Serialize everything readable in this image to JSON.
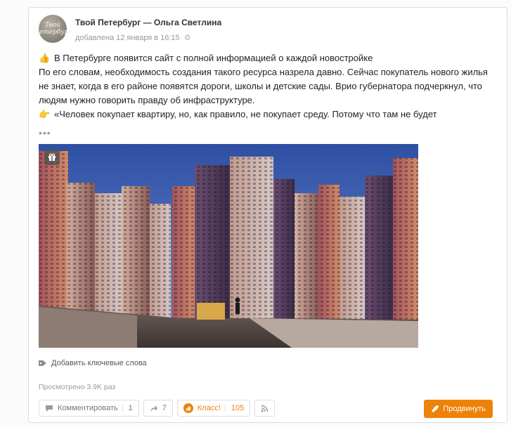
{
  "post": {
    "avatar_text": "Твой Петербург",
    "author": "Твой Петербург — Ольга Светлина",
    "date": "добавлена 12 января в 16:15",
    "headline": "В Петербурге появится сайт с полной информацией о каждой новостройке",
    "body": "По его словам, необходимость создания такого ресурса назрела давно. Сейчас покупатель нового жилья не знает, когда в его районе появятся дороги, школы и детские сады. Врио губернатора подчеркнул, что людям нужно говорить правду об инфраструктуре.",
    "quote": "«Человек покупает квартиру, но, как правило, не покупает среду. Потому что там не будет",
    "more": "•••",
    "image_icon": "gift-icon"
  },
  "keywords_label": "Добавить ключевые слова",
  "views": "Просмотрено 3.9K раз",
  "actions": {
    "comment_label": "Комментировать",
    "comment_count": "1",
    "share_count": "7",
    "klass_label": "Класс!",
    "klass_count": "105",
    "promote_label": "Продвинуть"
  },
  "colors": {
    "accent": "#ee8208",
    "sky": "#3a5aa8"
  }
}
